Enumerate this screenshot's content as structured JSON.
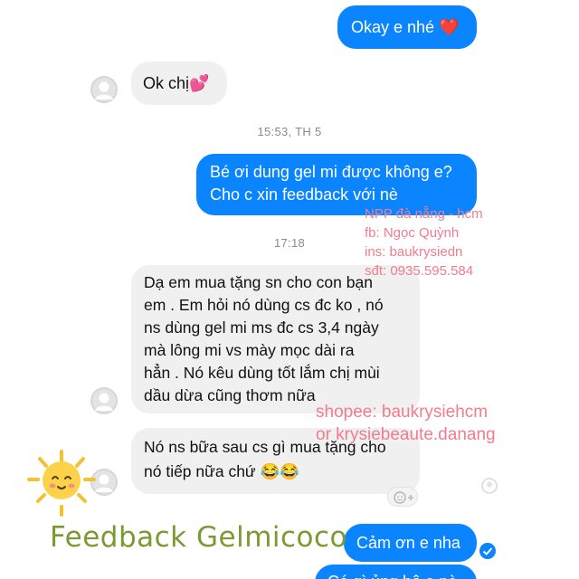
{
  "messages": {
    "m1": "Okay e nhé ❤️",
    "m2": "Ok chị💕",
    "t1": "15:53, TH 5",
    "m3": "Bé ơi dung gel mi được không e?\nCho c xin feedback với nè",
    "t2": "17:18",
    "m4": "Dạ em mua tặng sn cho con bạn\nem . Em hỏi nó dùng cs đc ko , nó\nns dùng gel mi ms đc cs 3,4 ngày\nmà lông mi vs mày mọc dài ra\nhẳn . Nó kêu dùng tốt lắm chị mùi\ndầu dừa cũng thơm nữa",
    "m5": "Nó ns bữa sau cs gì mua tặng cho\nnó tiếp nữa chứ 😂😂",
    "m6": "Cảm ơn e nha",
    "m7": "Có gì ủng hộ e nè"
  },
  "watermark": {
    "line1": "NPP đà nẵng - hcm",
    "line2": "fb: Ngọc Quỳnh",
    "line3": "ins: baukrysiedn",
    "line4": "sđt: 0935.595.584",
    "line5": "shopee: baukrysiehcm",
    "line6": "or krysiebeaute.danang"
  },
  "caption": "Feedback Gelmicoco",
  "colors": {
    "outgoing_bubble": "#0a84ff",
    "incoming_bubble": "#f0f0f0",
    "watermark": "#f27c8e",
    "caption": "#7a9a32"
  },
  "icons": [
    "user-avatar-icon",
    "sun-sticker-icon",
    "add-reaction-icon",
    "seen-check-icon"
  ]
}
